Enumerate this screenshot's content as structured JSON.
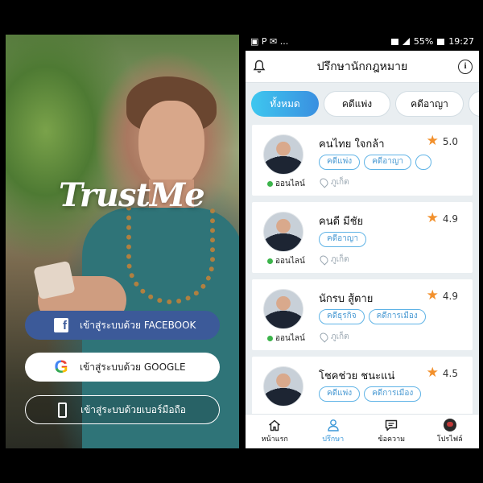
{
  "login": {
    "logo": "TrustMe",
    "facebook_label": "เข้าสู่ระบบด้วย FACEBOOK",
    "google_label": "เข้าสู่ระบบด้วย GOOGLE",
    "phone_label": "เข้าสู่ระบบด้วยเบอร์มือถือ",
    "facebook_icon": "f",
    "google_icon": "G"
  },
  "statusbar": {
    "left_icons": "▣ P ✉ ...",
    "battery": "55%",
    "time": "19:27"
  },
  "header": {
    "title": "ปรึกษานักกฎหมาย",
    "info_icon": "i"
  },
  "tabs": [
    {
      "label": "ทั้งหมด"
    },
    {
      "label": "คดีแพ่ง"
    },
    {
      "label": "คดีอาญา"
    },
    {
      "label": ""
    }
  ],
  "lawyers": [
    {
      "name": "คนไทย ใจกล้า",
      "rating": "5.0",
      "status": "ออนไลน์",
      "location": "ภูเก็ต",
      "tags": [
        "คดีแพ่ง",
        "คดีอาญา",
        ""
      ]
    },
    {
      "name": "คนดี มีชัย",
      "rating": "4.9",
      "status": "ออนไลน์",
      "location": "ภูเก็ต",
      "tags": [
        "คดีอาญา"
      ]
    },
    {
      "name": "นักรบ สู้ตาย",
      "rating": "4.9",
      "status": "ออนไลน์",
      "location": "ภูเก็ต",
      "tags": [
        "คดีธุรกิจ",
        "คดีการเมือง"
      ]
    },
    {
      "name": "โชคช่วย ชนะแน่",
      "rating": "4.5",
      "status": "",
      "location": "",
      "tags": [
        "คดีแพ่ง",
        "คดีการเมือง"
      ]
    }
  ],
  "nav": [
    {
      "label": "หน้าแรก",
      "icon": "home-icon"
    },
    {
      "label": "ปรึกษา",
      "icon": "person-icon"
    },
    {
      "label": "ข้อความ",
      "icon": "chat-icon"
    },
    {
      "label": "โปรไฟล์",
      "icon": "profile-avatar-icon"
    }
  ],
  "colors": {
    "accent": "#3a97d8",
    "facebook": "#3c5a99",
    "star": "#f2902c",
    "online": "#3cb44b"
  }
}
